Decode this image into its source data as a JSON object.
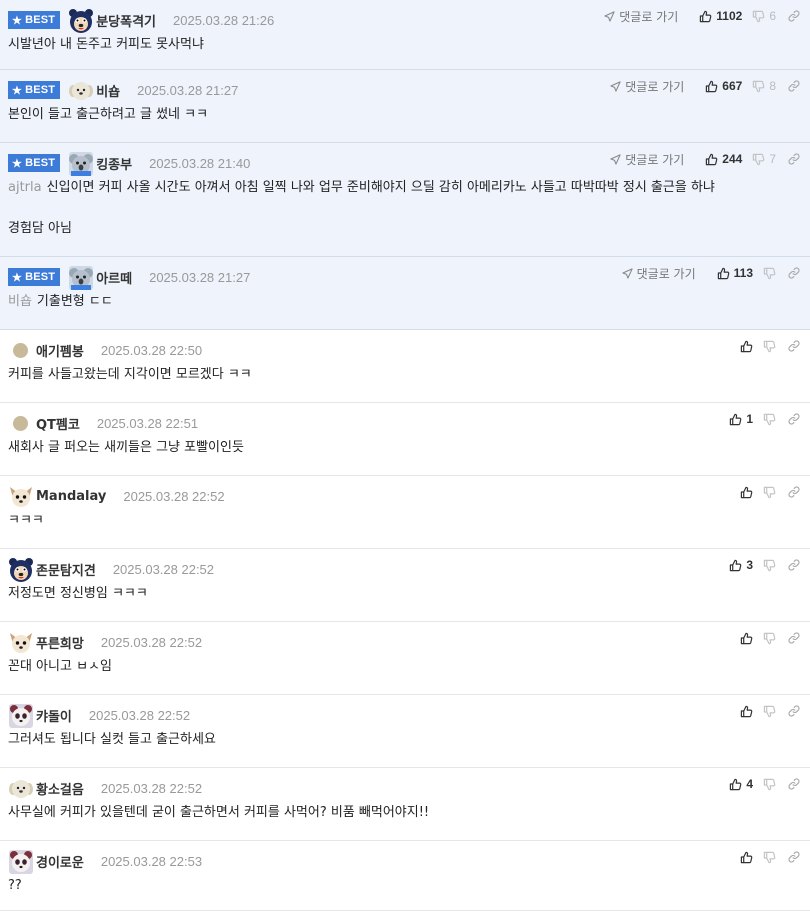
{
  "ui": {
    "best_label": "BEST",
    "reply_link": "댓글로 가기"
  },
  "colors": {
    "best_badge": "#3c7bd8",
    "best_background": "#eef3fc",
    "date": "#999999",
    "mention": "#999999"
  },
  "comments": [
    {
      "best": true,
      "avatar": "bear-icon",
      "nick": "분당폭격기",
      "date": "2025.03.28 21:26",
      "up": "1102",
      "down": "6",
      "mention": "",
      "lines": [
        "시발년아 내 돈주고 커피도 못사먹냐"
      ]
    },
    {
      "best": true,
      "avatar": "dog-face-icon",
      "nick": "비숍",
      "date": "2025.03.28 21:27",
      "up": "667",
      "down": "8",
      "mention": "",
      "lines": [
        "본인이 들고 출근하려고 글 썼네 ㅋㅋ"
      ]
    },
    {
      "best": true,
      "avatar": "koala-icon",
      "nick": "킹종부",
      "date": "2025.03.28 21:40",
      "up": "244",
      "down": "7",
      "mention": "ajtrla",
      "lines": [
        "신입이면 커피 사올 시간도 아껴서 아침 일찍 나와 업무 준비해야지 으딜 감히 아메리카노 사들고 따박따박 정시 출근을 하냐",
        "",
        "경험담 아님"
      ]
    },
    {
      "best": true,
      "avatar": "koala-icon",
      "nick": "아르떼",
      "date": "2025.03.28 21:27",
      "up": "113",
      "down": "",
      "mention": "비숍",
      "lines": [
        "기출변형 ㄷㄷ"
      ]
    },
    {
      "best": false,
      "avatar": "dot-icon",
      "nick": "애기펨봉",
      "date": "2025.03.28 22:50",
      "up": "",
      "down": "",
      "mention": "",
      "lines": [
        "커피를 사들고왔는데 지각이면 모르겠다 ㅋㅋ"
      ]
    },
    {
      "best": false,
      "avatar": "dot-icon",
      "nick": "QT펨코",
      "date": "2025.03.28 22:51",
      "up": "1",
      "down": "",
      "mention": "",
      "lines": [
        "새회사 글 퍼오는 새끼들은 그냥 포빨이인듯"
      ]
    },
    {
      "best": false,
      "avatar": "chihuahua-icon",
      "nick": "Mandalay",
      "date": "2025.03.28 22:52",
      "up": "",
      "down": "",
      "mention": "",
      "lines": [
        "ㅋㅋㅋ"
      ]
    },
    {
      "best": false,
      "avatar": "bear-icon",
      "nick": "존문탐지견",
      "date": "2025.03.28 22:52",
      "up": "3",
      "down": "",
      "mention": "",
      "lines": [
        "저정도면 정신병임 ㅋㅋㅋ"
      ]
    },
    {
      "best": false,
      "avatar": "chihuahua-icon",
      "nick": "푸른희망",
      "date": "2025.03.28 22:52",
      "up": "",
      "down": "",
      "mention": "",
      "lines": [
        "꼰대 아니고 ㅂㅅ임"
      ]
    },
    {
      "best": false,
      "avatar": "panda-icon",
      "nick": "캬돌이",
      "date": "2025.03.28 22:52",
      "up": "",
      "down": "",
      "mention": "",
      "lines": [
        "그러셔도 됩니다 실컷 들고 출근하세요"
      ]
    },
    {
      "best": false,
      "avatar": "dog-face-icon",
      "nick": "황소걸음",
      "date": "2025.03.28 22:52",
      "up": "4",
      "down": "",
      "mention": "",
      "lines": [
        "사무실에 커피가 있을텐데 굳이 출근하면서 커피를 사먹어? 비품 빼먹어야지!!"
      ]
    },
    {
      "best": false,
      "avatar": "panda-icon",
      "nick": "경이로운",
      "date": "2025.03.28 22:53",
      "up": "",
      "down": "",
      "mention": "",
      "lines": [
        "??"
      ]
    }
  ]
}
